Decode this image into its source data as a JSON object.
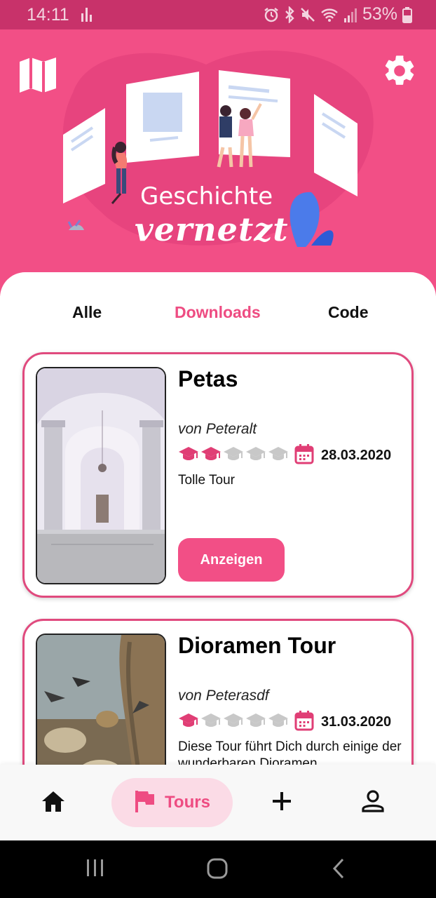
{
  "status_bar": {
    "time": "14:11",
    "battery": "53%",
    "icons": [
      "signal-icon",
      "alarm-icon",
      "bluetooth-icon",
      "mute-icon",
      "wifi-icon",
      "cell-signal-icon",
      "battery-icon"
    ]
  },
  "header": {
    "title_line_1": "Geschichte",
    "title_line_2": "vernetzt",
    "left_icon": "map-icon",
    "right_icon": "gear-icon"
  },
  "tabs": [
    {
      "label": "Alle",
      "active": false
    },
    {
      "label": "Downloads",
      "active": true
    },
    {
      "label": "Code",
      "active": false
    }
  ],
  "tours": [
    {
      "title": "Petas",
      "author": "von Peteralt",
      "difficulty": 2,
      "difficulty_max": 5,
      "date": "28.03.2020",
      "description": "Tolle Tour",
      "button_label": "Anzeigen"
    },
    {
      "title": "Dioramen Tour",
      "author": "von Peterasdf",
      "difficulty": 1,
      "difficulty_max": 5,
      "date": "31.03.2020",
      "description": "Diese Tour führt Dich durch einige der wunderbaren Dioramen"
    }
  ],
  "bottom_nav": {
    "tours_label": "Tours",
    "items": [
      "home-icon",
      "flag-icon",
      "add-icon",
      "profile-icon"
    ]
  },
  "colors": {
    "primary": "#f24f86",
    "status_bar": "#c8326a",
    "inactive_cap": "#c8c8c8",
    "nav_pill": "#fbdbe6"
  }
}
